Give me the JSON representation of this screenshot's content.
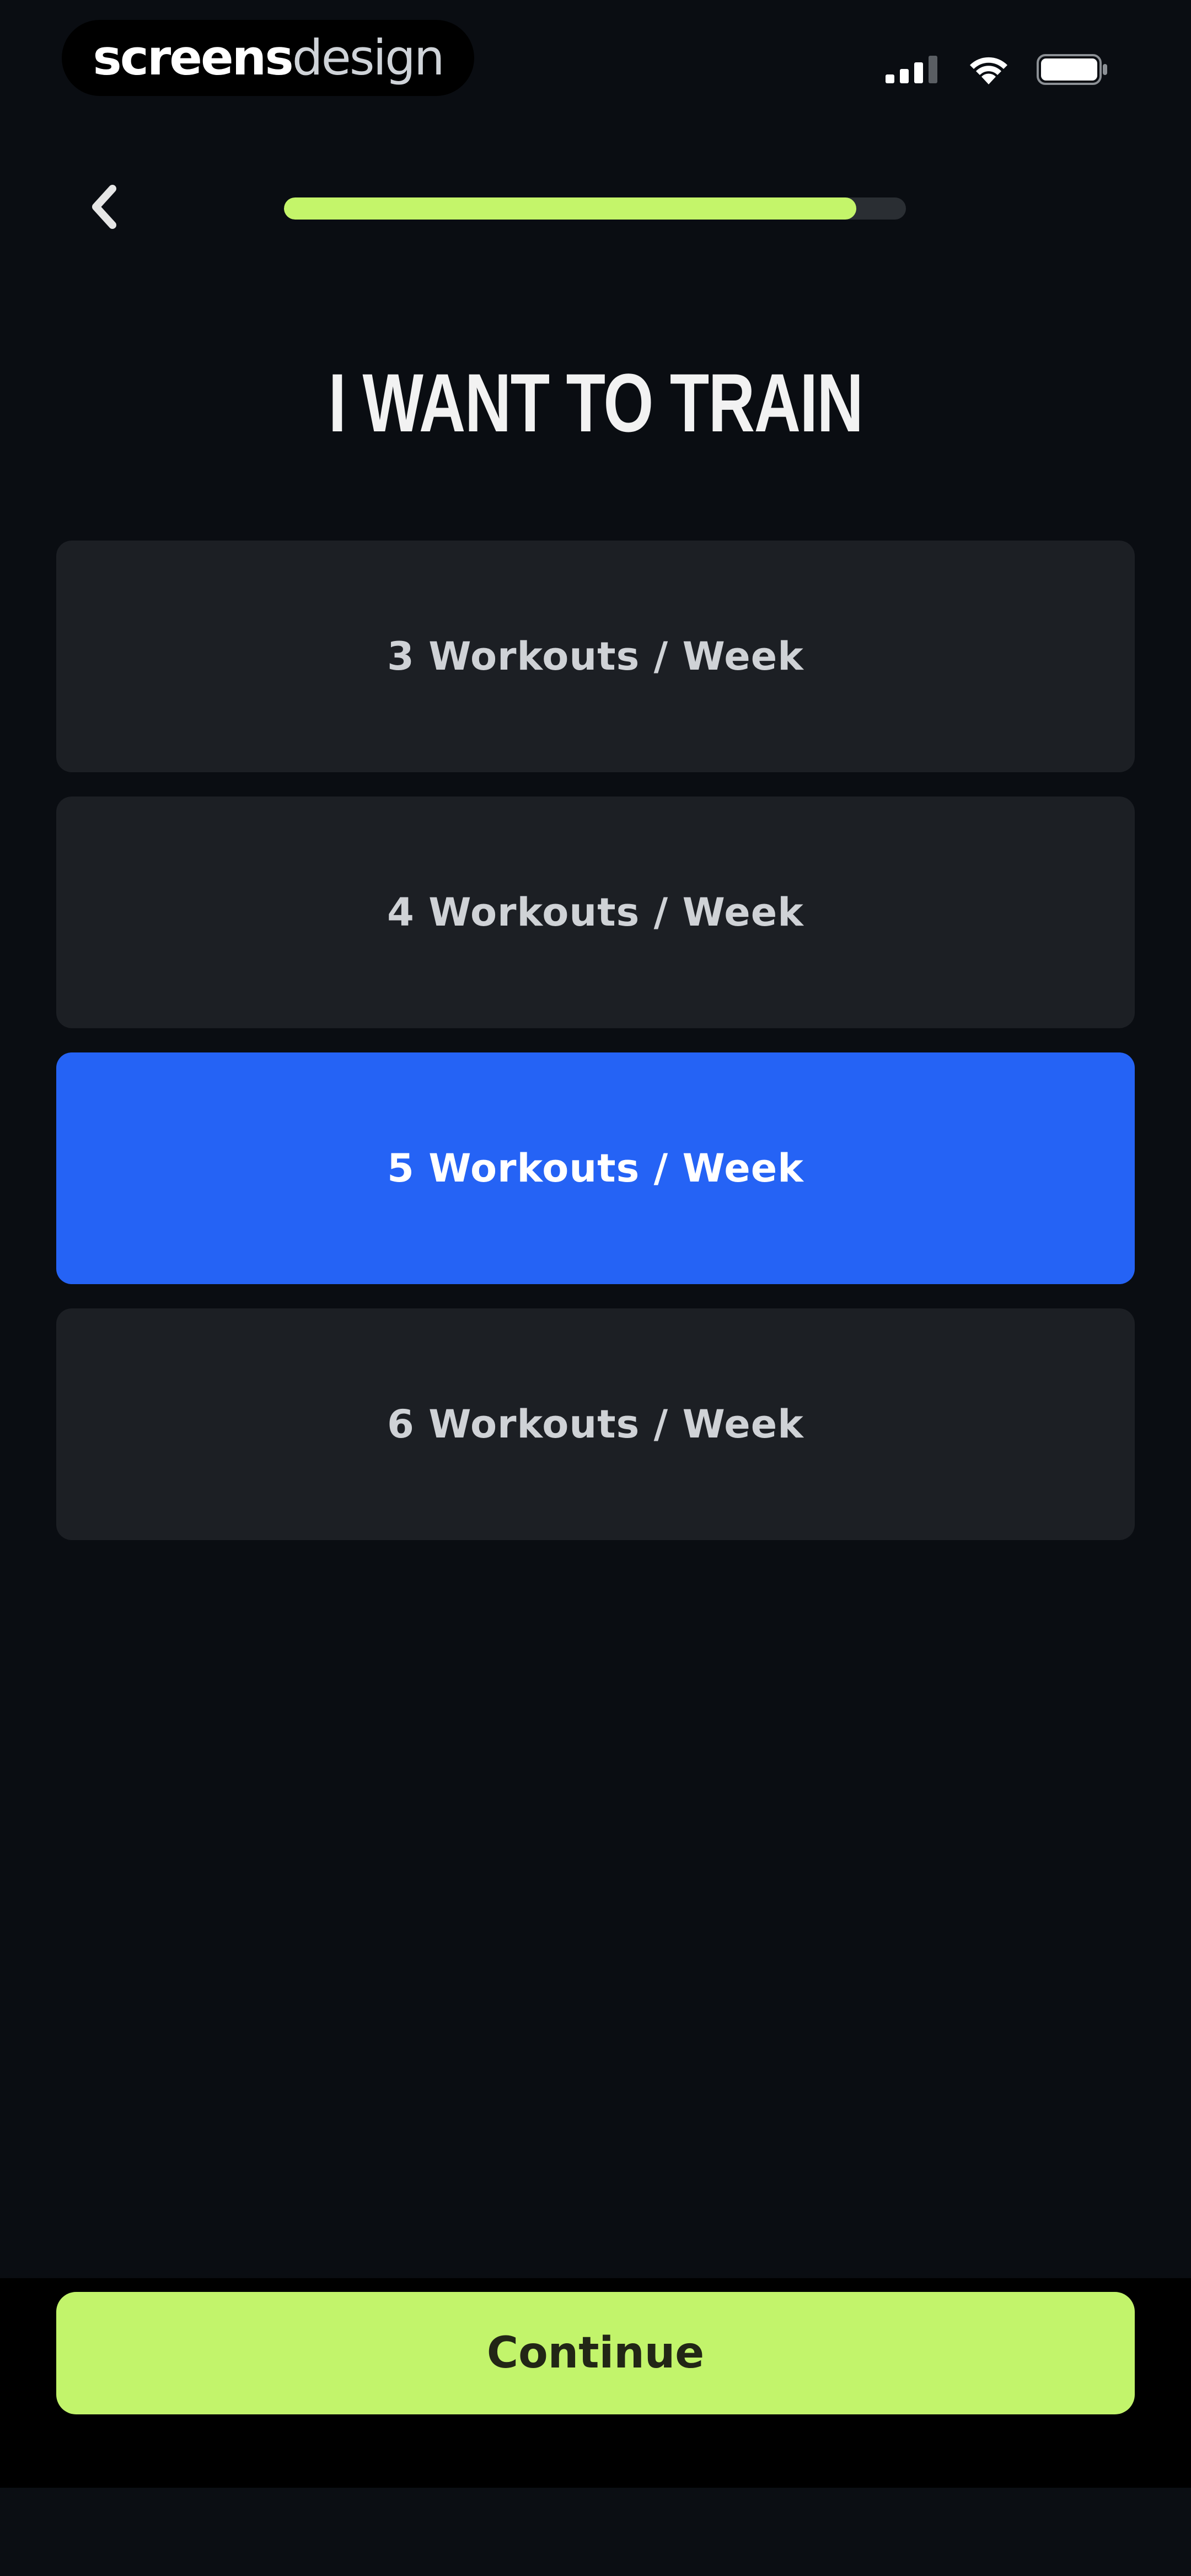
{
  "status_bar": {
    "brand": {
      "strong": "screens",
      "light": "design"
    },
    "icons": [
      "signal-icon",
      "wifi-icon",
      "battery-icon"
    ]
  },
  "header": {
    "back_icon": "chevron-left-icon",
    "progress": 0.92,
    "progress_color": "#c4f56a"
  },
  "title": "I WANT TO TRAIN",
  "options": [
    {
      "label": "3 Workouts / Week",
      "selected": false
    },
    {
      "label": "4 Workouts / Week",
      "selected": false
    },
    {
      "label": "5 Workouts / Week",
      "selected": true
    },
    {
      "label": "6 Workouts / Week",
      "selected": false
    }
  ],
  "continue_label": "Continue",
  "colors": {
    "background": "#0a0d12",
    "option_bg": "#1c1f24",
    "selected_bg": "#2563f5",
    "accent": "#c2f46b"
  }
}
